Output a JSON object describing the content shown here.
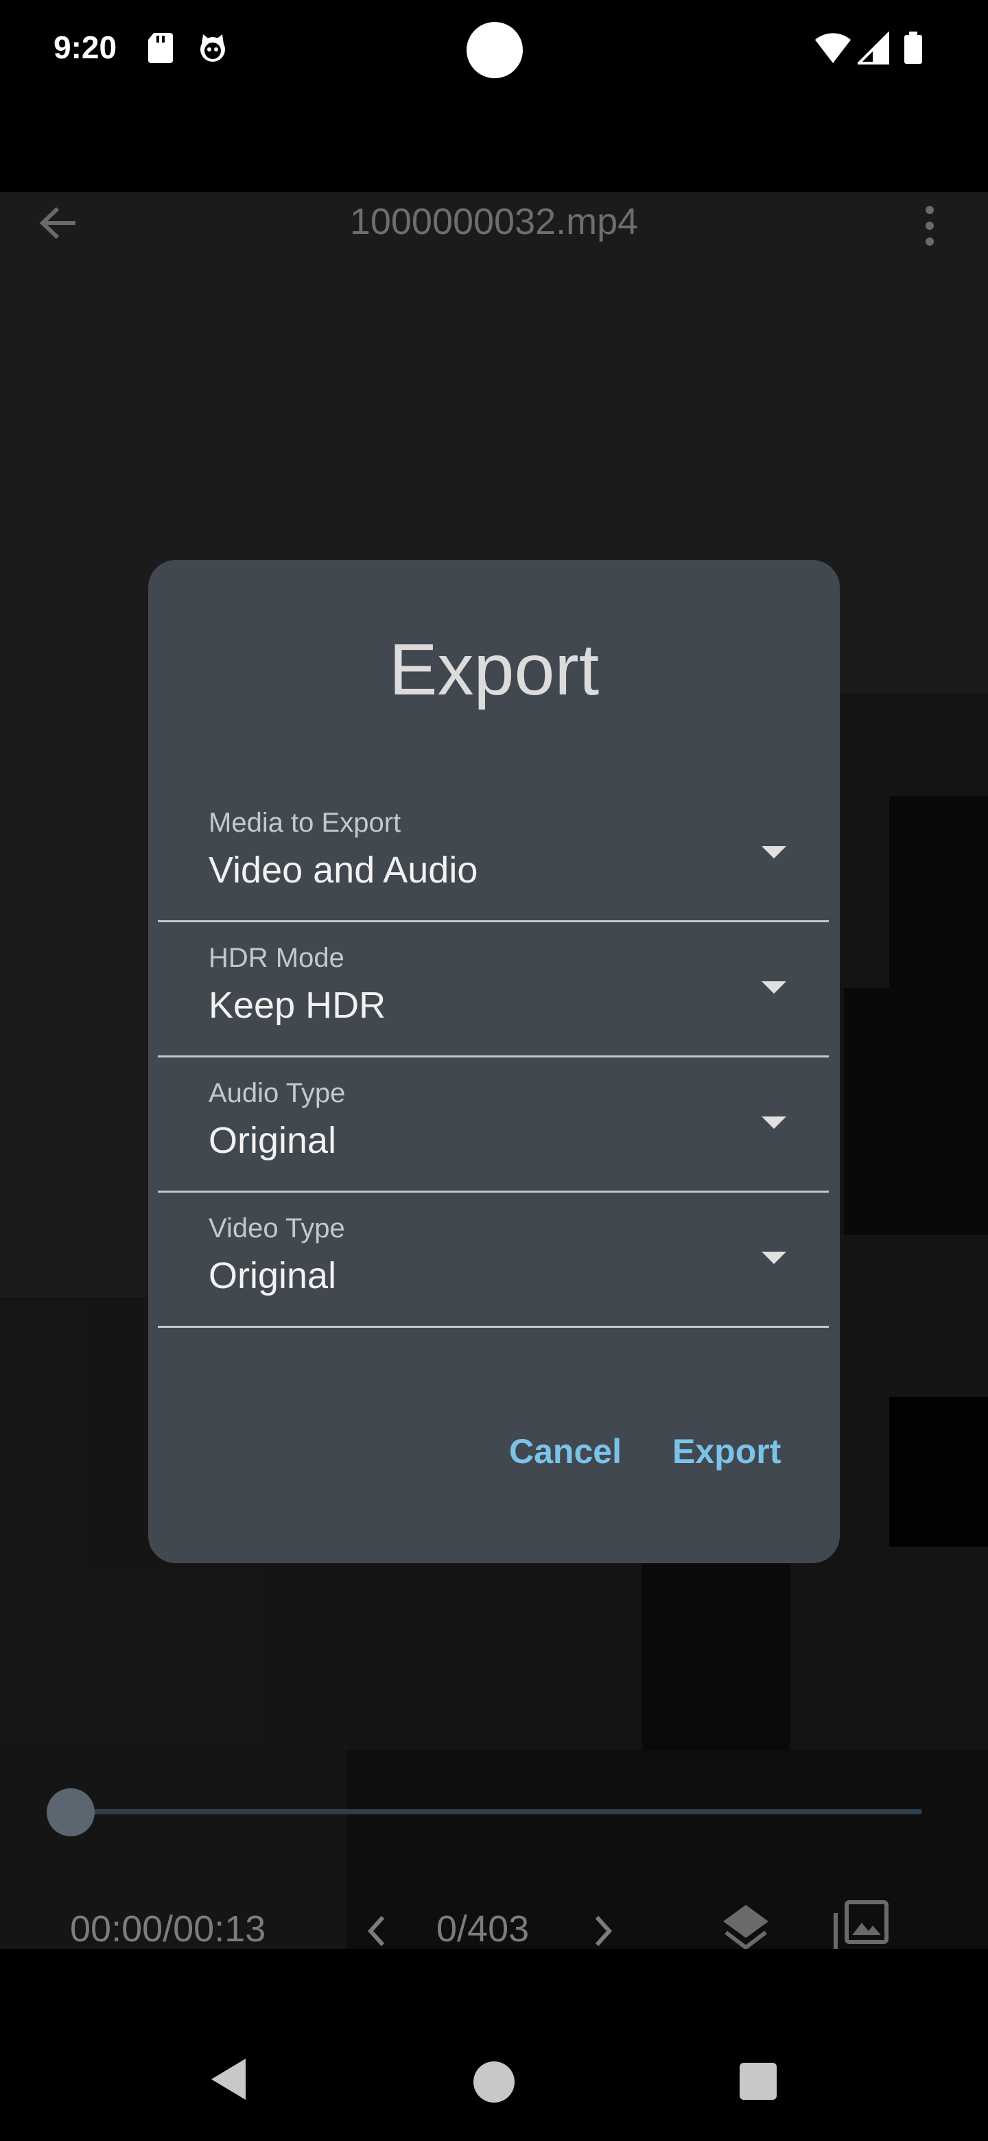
{
  "status_bar": {
    "time": "9:20"
  },
  "app_bar": {
    "title": "1000000032.mp4"
  },
  "player": {
    "time": "00:00/00:13",
    "frame": "0/403",
    "progress": 0.0
  },
  "dialog": {
    "title": "Export",
    "fields": [
      {
        "label": "Media to Export",
        "value": "Video and Audio"
      },
      {
        "label": "HDR Mode",
        "value": "Keep HDR"
      },
      {
        "label": "Audio Type",
        "value": "Original"
      },
      {
        "label": "Video Type",
        "value": "Original"
      }
    ],
    "cancel_label": "Cancel",
    "export_label": "Export"
  },
  "colors": {
    "accent": "#7cc3ea",
    "dialog_bg": "#414850"
  }
}
